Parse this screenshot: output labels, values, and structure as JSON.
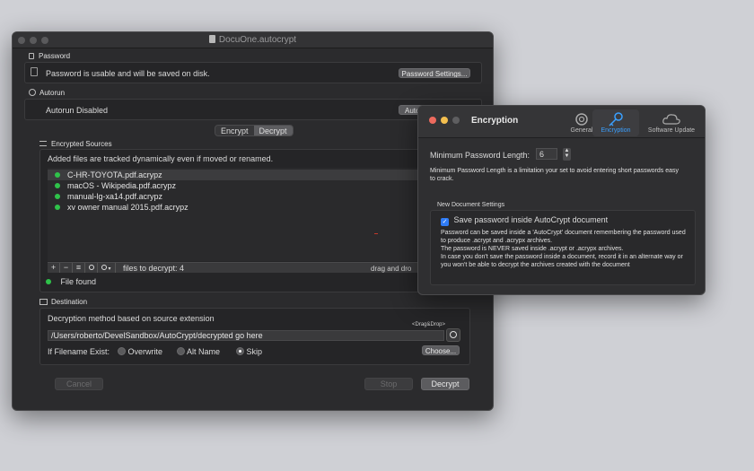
{
  "main_window": {
    "title": "DocuOne.autocrypt",
    "password": {
      "section_label": "Password",
      "status": "Password is usable and will be saved on disk.",
      "settings_button": "Password Settings..."
    },
    "autorun": {
      "section_label": "Autorun",
      "status": "Autorun Disabled",
      "button": "Autor"
    },
    "mode_tabs": [
      "Encrypt",
      "Decrypt"
    ],
    "selected_mode": "Decrypt",
    "sources": {
      "section_label": "Encrypted Sources",
      "hint": "Added files are tracked dynamically  even if moved or renamed.",
      "files": [
        "C-HR-TOYOTA.pdf.acrypz",
        "macOS - Wikipedia.pdf.acrypz",
        "manual-lg-xa14.pdf.acrypz",
        "xv owner manual 2015.pdf.acrypz"
      ],
      "toolbar": {
        "add": "+",
        "remove": "−",
        "list": "≡",
        "count_text": "files to decrypt: 4",
        "drag_hint": "drag and dro"
      },
      "found_status": "File found"
    },
    "destination": {
      "section_label": "Destination",
      "method": "Decryption method based on source extension",
      "drag_drop_label": "<Drag&Drop>",
      "path": "/Users/roberto/DevelSandbox/AutoCrypt/decrypted go here",
      "choose_button": "Choose...",
      "if_exists_label": "If Filename Exist:",
      "options": [
        "Overwrite",
        "Alt Name",
        "Skip"
      ],
      "selected_option": "Skip"
    },
    "buttons": {
      "cancel": "Cancel",
      "stop": "Stop",
      "decrypt": "Decrypt"
    }
  },
  "prefs_window": {
    "title": "Encryption",
    "tabs": [
      "General",
      "Encryption",
      "Software Update"
    ],
    "active_tab": "Encryption",
    "min_length_label": "Minimum Password Length:",
    "min_length_value": "6",
    "min_length_note": "Minimum Password Length is a limitation your set to avoid entering short passwords easy to crack.",
    "new_doc_label": "New Document Settings",
    "save_checkbox_label": "Save password inside AutoCrypt document",
    "save_checked": true,
    "save_note_1": "Password can be saved inside a 'AutoCrypt' document remembering the password used to produce .acrypt and .acrypx archives.",
    "save_note_2": "The password is NEVER saved inside .acrypt or .acrypx archives.",
    "save_note_3": "In case you don't save the password inside a document, record it in an alternate way or you won't be able to decrypt the archives created with the document"
  },
  "colors": {
    "accent": "#3aa0ff",
    "green_status": "#2fc24a",
    "close_red": "#ed6a5e",
    "minimize_yellow": "#f4bf4f"
  }
}
